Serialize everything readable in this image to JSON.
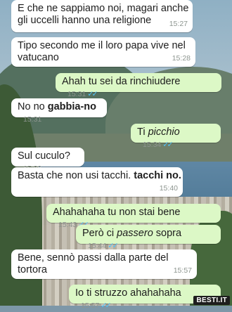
{
  "messages": [
    {
      "line1": "E che ne sappiamo noi, magari anche",
      "line2": "gli uccelli hanno una religione",
      "time": "15:27"
    },
    {
      "line1": "Tipo secondo me il loro papa vive nel",
      "line2": "vatucano",
      "time": "15:28"
    },
    {
      "text": "Ahah tu sei da rinchiudere",
      "time": "15:31",
      "status": "read"
    },
    {
      "text_plain": "No no ",
      "text_bold": "gabbia-no",
      "time": "15:31"
    },
    {
      "text_plain": "Ti ",
      "text_italic": "picchio",
      "time": "15:34",
      "status": "read"
    },
    {
      "text": "Sul cuculo?",
      "time": "15:39"
    },
    {
      "text_plain": "Basta che non usi tacchi. ",
      "text_bold": "tacchi no.",
      "time": "15:40"
    },
    {
      "text": "Ahahahaha tu non stai bene",
      "time": "15:43",
      "status": "read"
    },
    {
      "text_plain": "Però ci ",
      "text_italic": "passero",
      "text_after": " sopra",
      "time": "15:44",
      "status": "read"
    },
    {
      "line1": "Bene, sennò passi dalla parte del",
      "line2": "tortora",
      "time": "15:57"
    },
    {
      "text": "Io ti struzzo ahahahaha",
      "time": "15:57",
      "status": "read"
    }
  ],
  "ticks": "✓✓",
  "watermark": "BESTI.IT",
  "colors": {
    "incoming": "#ffffff",
    "outgoing": "#dcf8c6",
    "read_ticks": "#4fc3f7"
  }
}
